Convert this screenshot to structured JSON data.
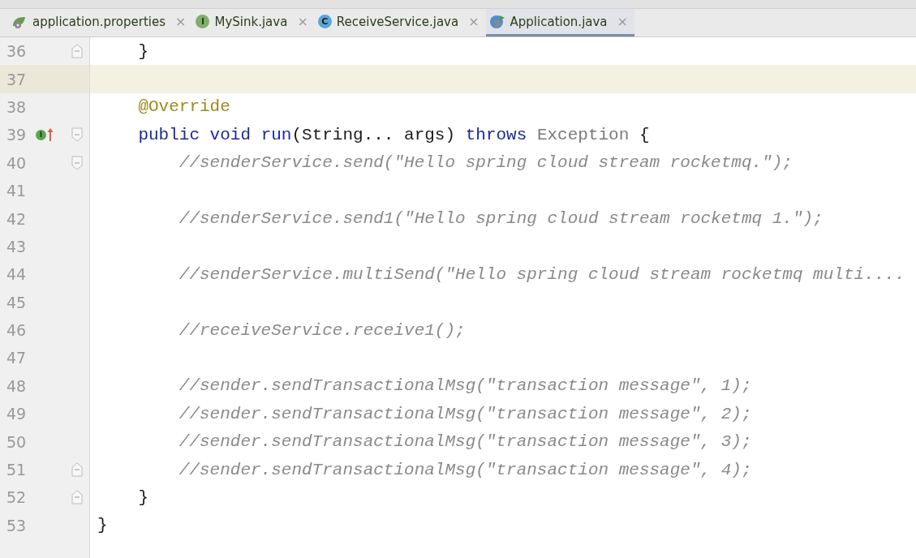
{
  "tabs": [
    {
      "label": "application.properties",
      "kind": "properties",
      "close": "×",
      "selected": false
    },
    {
      "label": "MySink.java",
      "kind": "interface",
      "icon_letter": "I",
      "close": "×",
      "selected": false
    },
    {
      "label": "ReceiveService.java",
      "kind": "class",
      "icon_letter": "C",
      "close": "×",
      "selected": false
    },
    {
      "label": "Application.java",
      "kind": "runnable-class",
      "close": "×",
      "selected": true
    }
  ],
  "editor": {
    "lines": [
      {
        "number": "36",
        "current": false,
        "gutter_icons": [
          {
            "kind": "fold-end"
          }
        ],
        "tokens": [
          {
            "kind": "plain",
            "text": "    }"
          }
        ]
      },
      {
        "number": "37",
        "current": true
      },
      {
        "number": "38",
        "current": false,
        "tokens": [
          {
            "kind": "annotation",
            "text": "    @Override"
          }
        ]
      },
      {
        "number": "39",
        "current": false,
        "gutter_icons": [
          {
            "kind": "implements",
            "letter": "I"
          },
          {
            "kind": "up-arrow"
          },
          {
            "kind": "fold-start"
          }
        ],
        "tokens": [
          {
            "kind": "keyword",
            "text": "    public void "
          },
          {
            "kind": "method",
            "text": "run"
          },
          {
            "kind": "plain",
            "text": "(String... args) "
          },
          {
            "kind": "keyword",
            "text": "throws "
          },
          {
            "kind": "dim",
            "text": "Exception "
          },
          {
            "kind": "plain",
            "text": "{"
          }
        ]
      },
      {
        "number": "40",
        "current": false,
        "gutter_icons": [
          {
            "kind": "fold-start"
          }
        ],
        "tokens": [
          {
            "kind": "comment",
            "text": "        //senderService.send(\"Hello spring cloud stream rocketmq.\");"
          }
        ]
      },
      {
        "number": "41",
        "current": false
      },
      {
        "number": "42",
        "current": false,
        "tokens": [
          {
            "kind": "comment",
            "text": "        //senderService.send1(\"Hello spring cloud stream rocketmq 1.\");"
          }
        ]
      },
      {
        "number": "43",
        "current": false
      },
      {
        "number": "44",
        "current": false,
        "tokens": [
          {
            "kind": "comment",
            "text": "        //senderService.multiSend(\"Hello spring cloud stream rocketmq multi...."
          }
        ]
      },
      {
        "number": "45",
        "current": false
      },
      {
        "number": "46",
        "current": false,
        "tokens": [
          {
            "kind": "comment",
            "text": "        //receiveService.receive1();"
          }
        ]
      },
      {
        "number": "47",
        "current": false
      },
      {
        "number": "48",
        "current": false,
        "tokens": [
          {
            "kind": "comment",
            "text": "        //sender.sendTransactionalMsg(\"transaction message\", 1);"
          }
        ]
      },
      {
        "number": "49",
        "current": false,
        "tokens": [
          {
            "kind": "comment",
            "text": "        //sender.sendTransactionalMsg(\"transaction message\", 2);"
          }
        ]
      },
      {
        "number": "50",
        "current": false,
        "tokens": [
          {
            "kind": "comment",
            "text": "        //sender.sendTransactionalMsg(\"transaction message\", 3);"
          }
        ]
      },
      {
        "number": "51",
        "current": false,
        "gutter_icons": [
          {
            "kind": "fold-end"
          }
        ],
        "tokens": [
          {
            "kind": "comment",
            "text": "        //sender.sendTransactionalMsg(\"transaction message\", 4);"
          }
        ]
      },
      {
        "number": "52",
        "current": false,
        "gutter_icons": [
          {
            "kind": "fold-end"
          }
        ],
        "tokens": [
          {
            "kind": "plain",
            "text": "    }"
          }
        ]
      },
      {
        "number": "53",
        "current": false,
        "tokens": [
          {
            "kind": "plain",
            "text": "}"
          }
        ]
      }
    ]
  }
}
